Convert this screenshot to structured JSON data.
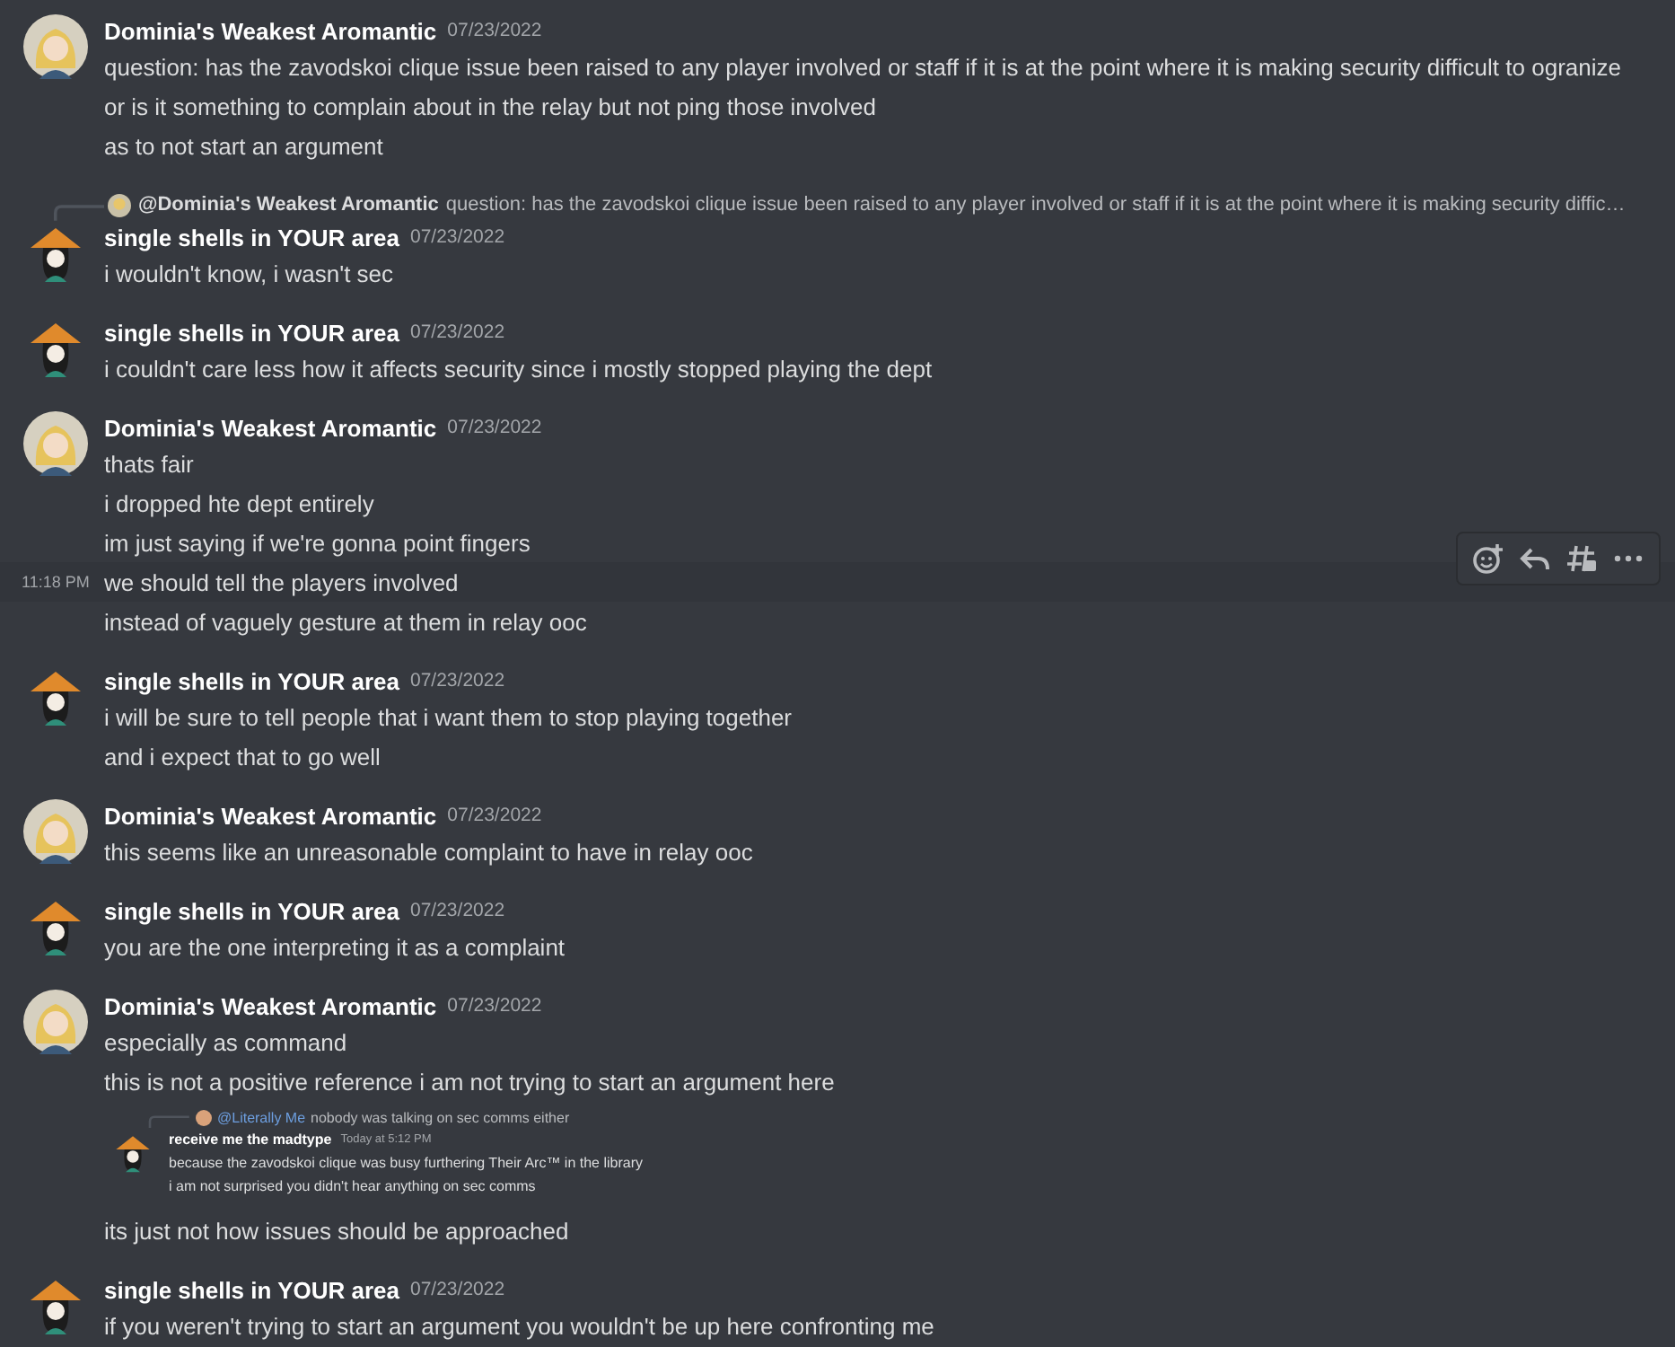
{
  "messages": [
    {
      "author": "Dominia's Weakest Aromantic",
      "kind": "blonde",
      "date": "07/23/2022",
      "lines": [
        {
          "kind": "text",
          "text": "question: has the zavodskoi clique issue been raised to any player involved or staff if it is at the point where it is making security difficult to ogranize",
          "hovered": false
        },
        {
          "kind": "text",
          "text": "or is it something to complain about in the relay but not ping those involved",
          "hovered": false
        },
        {
          "kind": "text",
          "text": "as to not start an argument",
          "hovered": false
        }
      ]
    },
    {
      "reply": {
        "mention": "@Dominia's Weakest Aromantic",
        "text": "question: has the zavodskoi clique issue been raised to any player involved or staff if it is at the point where it is making security diffic…"
      },
      "author": "single shells in YOUR area",
      "kind": "hat",
      "date": "07/23/2022",
      "lines": [
        {
          "kind": "text",
          "text": "i wouldn't know, i wasn't sec",
          "hovered": false
        }
      ]
    },
    {
      "author": "single shells in YOUR area",
      "kind": "hat",
      "date": "07/23/2022",
      "lines": [
        {
          "kind": "text",
          "text": "i couldn't care less how it affects security since i mostly stopped playing the dept",
          "hovered": false
        }
      ]
    },
    {
      "author": "Dominia's Weakest Aromantic",
      "kind": "blonde",
      "date": "07/23/2022",
      "lines": [
        {
          "kind": "text",
          "text": "thats fair",
          "hovered": false
        },
        {
          "kind": "text",
          "text": "i dropped hte dept entirely",
          "hovered": false
        },
        {
          "kind": "text",
          "text": "im just saying if we're gonna point fingers",
          "hovered": false
        },
        {
          "kind": "text",
          "text": "we should tell the players involved",
          "hovered": true,
          "time": "11:18 PM"
        },
        {
          "kind": "text",
          "text": "instead of vaguely gesture at them in relay ooc",
          "hovered": false
        }
      ]
    },
    {
      "author": "single shells in YOUR area",
      "kind": "hat",
      "date": "07/23/2022",
      "lines": [
        {
          "kind": "text",
          "text": "i will be sure to tell people that i want them to stop playing together",
          "hovered": false
        },
        {
          "kind": "text",
          "text": "and i expect that to go well",
          "hovered": false
        }
      ]
    },
    {
      "author": "Dominia's Weakest Aromantic",
      "kind": "blonde",
      "date": "07/23/2022",
      "lines": [
        {
          "kind": "text",
          "text": "this seems like an unreasonable complaint to have in relay ooc",
          "hovered": false
        }
      ]
    },
    {
      "author": "single shells in YOUR area",
      "kind": "hat",
      "date": "07/23/2022",
      "lines": [
        {
          "kind": "text",
          "text": "you are the one interpreting it as a complaint",
          "hovered": false
        }
      ]
    },
    {
      "author": "Dominia's Weakest Aromantic",
      "kind": "blonde",
      "date": "07/23/2022",
      "lines": [
        {
          "kind": "text",
          "text": "especially as command",
          "hovered": false
        },
        {
          "kind": "text",
          "text": "this is not a positive reference i am not trying to start an argument here",
          "hovered": false
        },
        {
          "kind": "screenshot",
          "reply": {
            "mention": "@Literally Me",
            "text": "nobody was talking on sec comms either"
          },
          "author": "receive me the madtype",
          "date": "Today at 5:12 PM",
          "lines": [
            "because the zavodskoi clique was busy furthering Their Arc™ in the library",
            "i am not surprised you didn't hear anything on sec comms"
          ]
        },
        {
          "kind": "text",
          "text": "its just not how issues should be approached",
          "hovered": false
        }
      ]
    },
    {
      "author": "single shells in YOUR area",
      "kind": "hat",
      "date": "07/23/2022",
      "lines": [
        {
          "kind": "text",
          "text": "if you weren't trying to start an argument you wouldn't be up here confronting me",
          "hovered": false
        }
      ]
    }
  ]
}
